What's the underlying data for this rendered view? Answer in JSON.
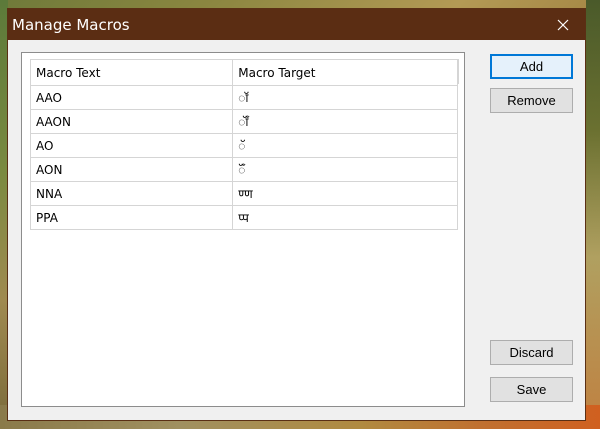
{
  "window": {
    "title": "Manage Macros",
    "close_glyph": "✕"
  },
  "grid": {
    "columns": [
      "Macro Text",
      "Macro Target"
    ],
    "rows": [
      {
        "text": "AAO",
        "target": "ॉ"
      },
      {
        "text": "AAON",
        "target": "ॉँ"
      },
      {
        "text": "AO",
        "target": "ॅ"
      },
      {
        "text": "AON",
        "target": "ॅँ"
      },
      {
        "text": "NNA",
        "target": "ण्ण"
      },
      {
        "text": "PPA",
        "target": "प्प"
      }
    ]
  },
  "buttons": {
    "add": "Add",
    "remove": "Remove",
    "discard": "Discard",
    "save": "Save"
  },
  "colors": {
    "titlebar": "#5b2d13",
    "accent": "#0078d7"
  }
}
